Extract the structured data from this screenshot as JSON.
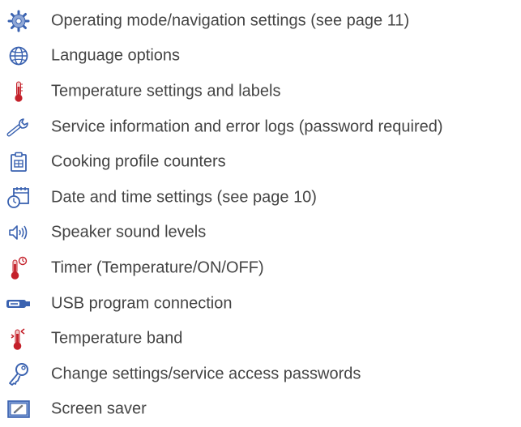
{
  "items": [
    {
      "icon": "gear-icon",
      "label": "Operating mode/navigation settings (see page 11)"
    },
    {
      "icon": "globe-icon",
      "label": "Language options"
    },
    {
      "icon": "thermometer-icon",
      "label": "Temperature settings and labels"
    },
    {
      "icon": "wrench-icon",
      "label": "Service information and error logs (password required)"
    },
    {
      "icon": "clipboard-icon",
      "label": "Cooking profile counters"
    },
    {
      "icon": "calendar-clock-icon",
      "label": "Date and time settings (see page 10)"
    },
    {
      "icon": "speaker-icon",
      "label": "Speaker sound levels"
    },
    {
      "icon": "thermometer-timer-icon",
      "label": "Timer (Temperature/ON/OFF)"
    },
    {
      "icon": "usb-icon",
      "label": "USB program connection"
    },
    {
      "icon": "thermometer-band-icon",
      "label": "Temperature band"
    },
    {
      "icon": "key-icon",
      "label": "Change settings/service access passwords"
    },
    {
      "icon": "screen-saver-icon",
      "label": "Screen saver"
    }
  ],
  "colors": {
    "text": "#444444",
    "icon_blue": "#3a62b0",
    "icon_red": "#c4202a",
    "icon_gray": "#7a7a7a"
  }
}
